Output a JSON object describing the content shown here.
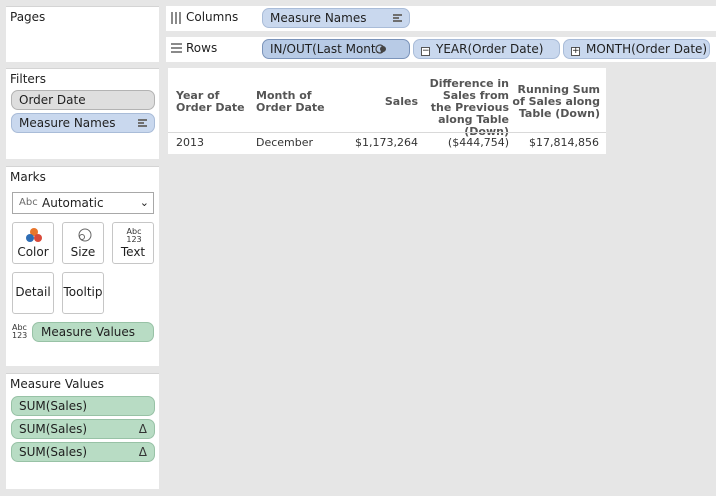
{
  "pages": {
    "title": "Pages"
  },
  "filters": {
    "title": "Filters",
    "items": [
      "Order Date",
      "Measure Names"
    ]
  },
  "marks": {
    "title": "Marks",
    "type_icon": "Abc",
    "type_value": "Automatic",
    "buttons": {
      "color": "Color",
      "size": "Size",
      "text": "Text",
      "detail": "Detail",
      "tooltip": "Tooltip"
    },
    "text_icon": "Abc 123",
    "field_pill": "Measure Values"
  },
  "measure_values": {
    "title": "Measure Values",
    "items": [
      "SUM(Sales)",
      "SUM(Sales)",
      "SUM(Sales)"
    ],
    "delta_symbol": "Δ"
  },
  "columns_shelf": {
    "label": "Columns",
    "pills": [
      "Measure Names"
    ]
  },
  "rows_shelf": {
    "label": "Rows",
    "pills": [
      "IN/OUT(Last Mont..",
      "YEAR(Order Date)",
      "MONTH(Order Date)"
    ],
    "minus": "−",
    "plus": "+"
  },
  "table": {
    "headers": [
      "Year of Order Date",
      "Month of Order Date",
      "Sales",
      "Difference in Sales from the Previous along Table (Down)",
      "Running Sum of Sales along Table (Down)"
    ],
    "rows": [
      [
        "2013",
        "December",
        "$1,173,264",
        "($444,754)",
        "$17,814,856"
      ]
    ]
  },
  "colors": {
    "blue_pill": "#c9d8ee",
    "green_pill": "#b8dcc4",
    "gray_pill": "#dedede",
    "background": "#e6e6e6"
  }
}
